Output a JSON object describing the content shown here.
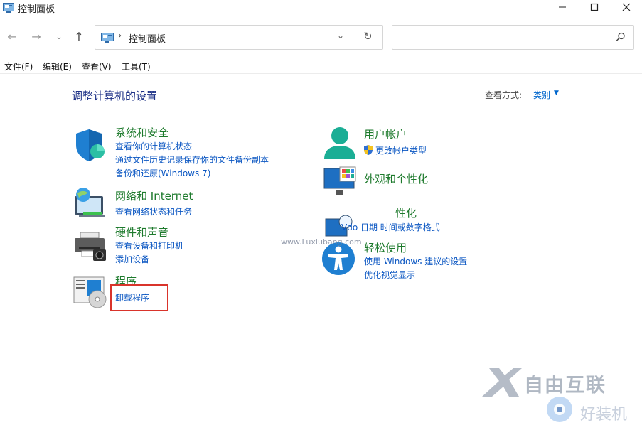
{
  "window": {
    "title": "控制面板",
    "controls": {
      "minimize": "—",
      "maximize": "☐",
      "close": "✕"
    }
  },
  "nav": {
    "back": "←",
    "forward": "→",
    "recent": "⌄",
    "up": "↑",
    "address_sep": "›",
    "address_text": "控制面板",
    "dropdown": "⌄",
    "refresh": "↻",
    "search_placeholder": ""
  },
  "menu": [
    "文件(F)",
    "编辑(E)",
    "查看(V)",
    "工具(T)"
  ],
  "main": {
    "heading": "调整计算机的设置",
    "view_label": "查看方式:",
    "view_value": "类别",
    "view_caret": "▼"
  },
  "left_categories": [
    {
      "title": "系统和安全",
      "links": [
        "查看你的计算机状态",
        "通过文件历史记录保存你的文件备份副本",
        "备份和还原(Windows 7)"
      ]
    },
    {
      "title": "网络和 Internet",
      "links": [
        "查看网络状态和任务"
      ]
    },
    {
      "title": "硬件和声音",
      "links": [
        "查看设备和打印机",
        "添加设备"
      ]
    },
    {
      "title": "程序",
      "links": [
        "卸载程序"
      ]
    }
  ],
  "right_categories": [
    {
      "title": "用户帐户",
      "links": [
        "更改帐户类型"
      ]
    },
    {
      "title": "外观和个性化",
      "links": []
    },
    {
      "title": "性化",
      "links": [
        "Vdo 日期 时间或数字格式"
      ]
    },
    {
      "title": "轻松使用",
      "links": [
        "使用 Windows 建议的设置",
        "优化视觉显示"
      ]
    }
  ],
  "watermark": {
    "url": "www.Luxiubang.com",
    "brand1": "自由互联",
    "brand2": "好装机"
  },
  "colors": {
    "category_title": "#1d7a2c",
    "link": "#0a56c2",
    "heading": "#1e3287",
    "highlight": "#d9342b"
  }
}
